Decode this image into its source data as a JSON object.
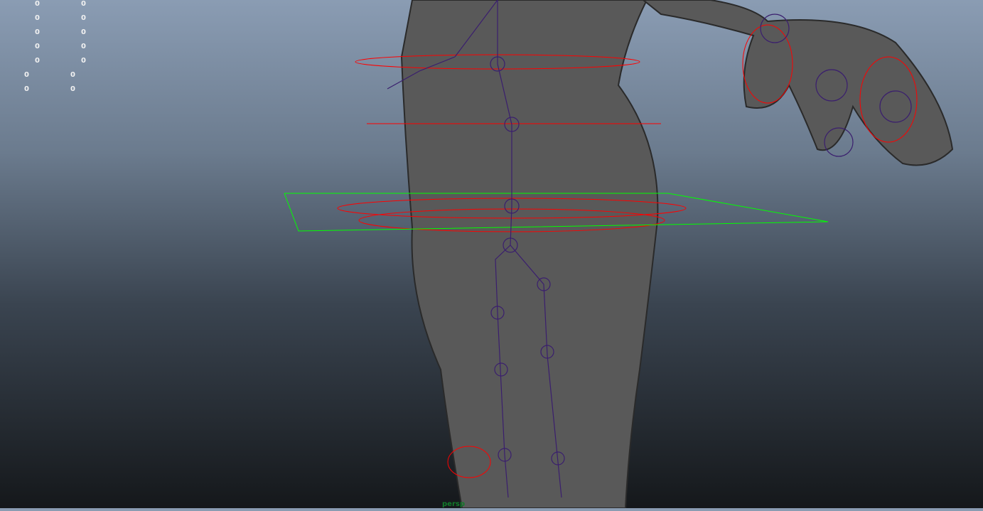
{
  "viewport": {
    "camera_label": "persp",
    "hud_rows": [
      [
        "0",
        "0"
      ],
      [
        "0",
        "0"
      ],
      [
        "0",
        "0"
      ],
      [
        "0",
        "0"
      ],
      [
        "0",
        "0"
      ],
      [
        "0",
        "0"
      ],
      [
        "0",
        "0"
      ]
    ]
  },
  "colors": {
    "mesh": "#5a5a5a",
    "joint": "#3a1e6e",
    "control": "#ff0000",
    "selected": "#00ff00",
    "camera_label": "#127a2a"
  }
}
